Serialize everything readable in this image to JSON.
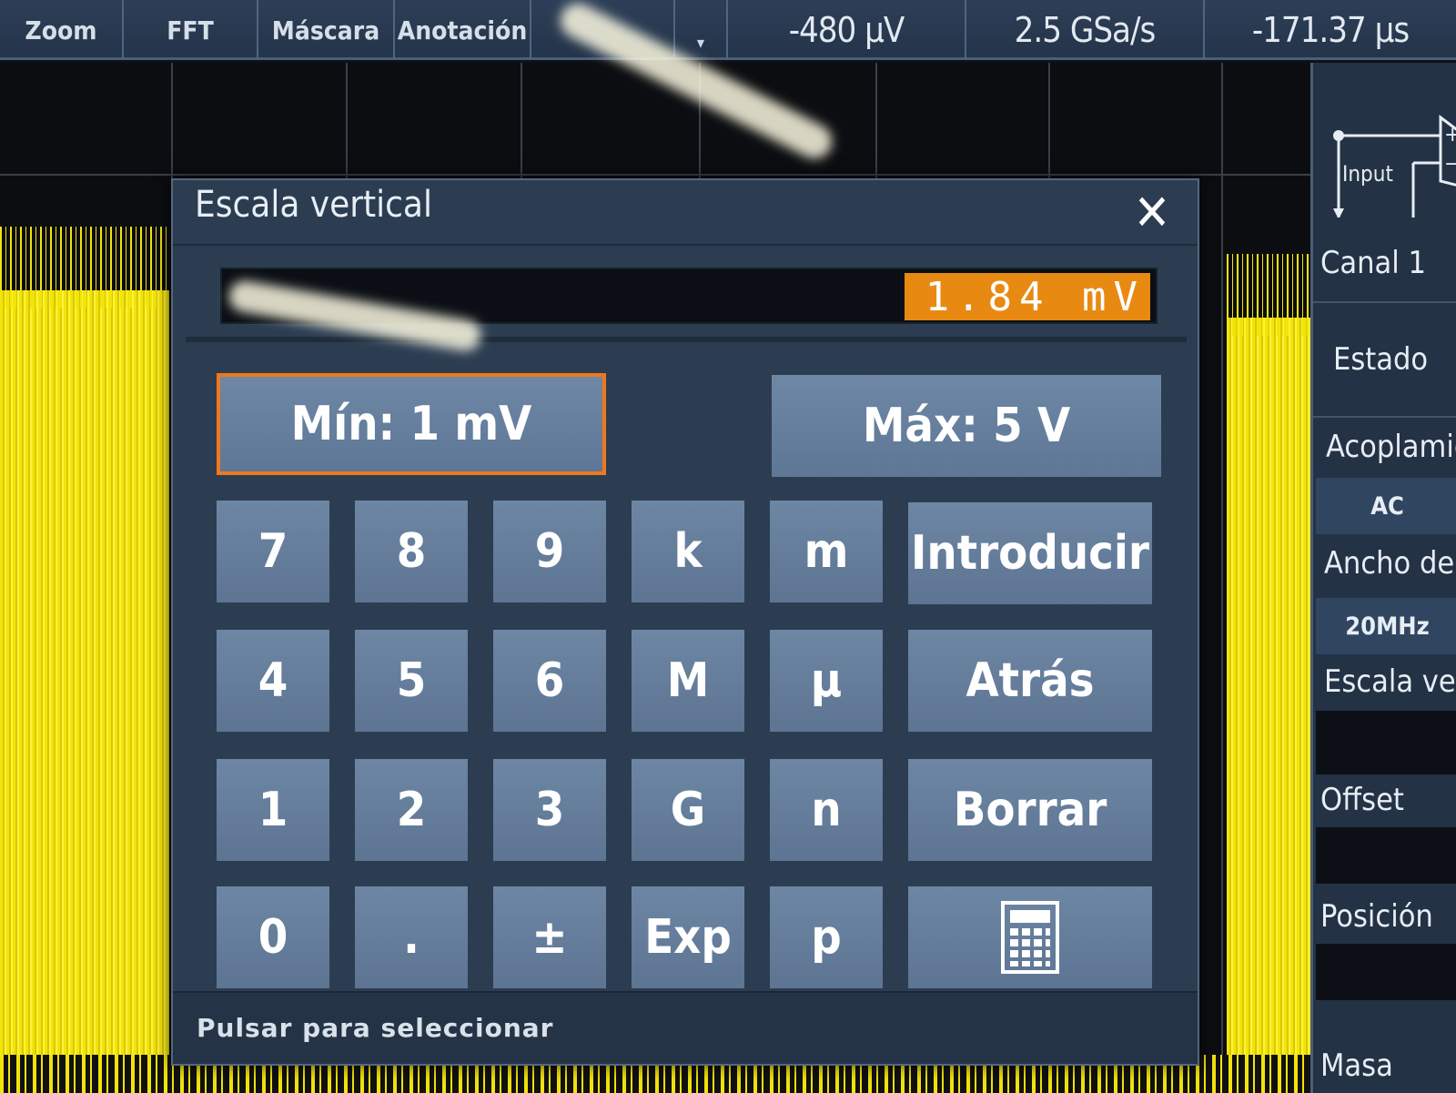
{
  "toolbar": {
    "buttons": [
      "Zoom",
      "FFT",
      "Máscara",
      "Anotación"
    ],
    "scroll_arrow": "▾",
    "readouts": [
      "-480 µV",
      "2.5 GSa/s",
      "-171.37 µs"
    ]
  },
  "side_panel": {
    "diagram_label": "Input",
    "channel": "Canal 1",
    "estado": "Estado",
    "acoplamiento_label": "Acoplamie",
    "acoplamiento_value": "AC",
    "ancho_label": "Ancho de b",
    "ancho_value": "20MHz",
    "escala_label": "Escala ver",
    "offset_label": "Offset",
    "posicion_label": "Posición",
    "masa_label": "Masa"
  },
  "dialog": {
    "title": "Escala vertical",
    "close_glyph": "✕",
    "entry_value": "1.84 mV",
    "min_label": "Mín: 1 mV",
    "max_label": "Máx: 5 V",
    "hint": "Pulsar para seleccionar"
  },
  "keypad": {
    "row1": [
      "7",
      "8",
      "9",
      "k",
      "m"
    ],
    "row2": [
      "4",
      "5",
      "6",
      "M",
      "µ"
    ],
    "row3": [
      "1",
      "2",
      "3",
      "G",
      "n"
    ],
    "row4": [
      "0",
      ".",
      "±",
      "Exp",
      "p"
    ],
    "enter": "Introducir",
    "back": "Atrás",
    "clear": "Borrar",
    "calculator_icon": "calculator-icon"
  },
  "colors": {
    "signal": "#f2e40a",
    "accent_orange": "#e88a12",
    "key_blue": "#6d86a4",
    "panel_bg": "#2c3d52"
  }
}
